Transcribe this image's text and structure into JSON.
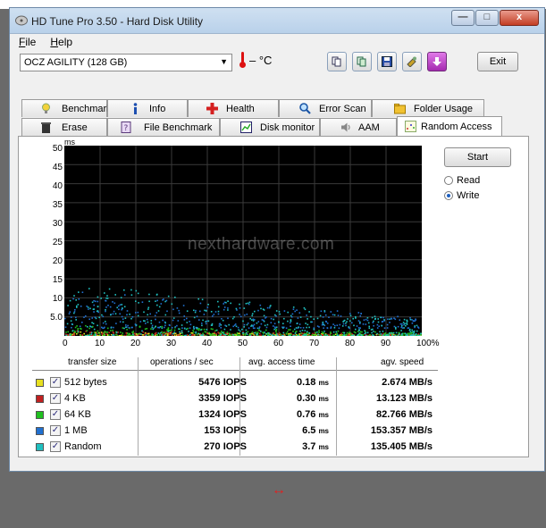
{
  "window": {
    "title": "HD Tune Pro 3.50 - Hard Disk Utility",
    "buttons": {
      "minimize": "—",
      "maximize": "□",
      "close": "x"
    }
  },
  "menu": [
    {
      "label": "File",
      "hotkey": "F",
      "rest": "ile"
    },
    {
      "label": "Help",
      "hotkey": "H",
      "rest": "elp"
    }
  ],
  "drive": {
    "selected": "OCZ AGILITY (128 GB)"
  },
  "temperature": {
    "text": "– °C"
  },
  "toolbar": {
    "icons": [
      "copy-icon",
      "copy-text-icon",
      "save-icon",
      "options-icon",
      "download-icon"
    ],
    "exit_label": "Exit"
  },
  "tabs": {
    "row_back": [
      {
        "label": "Benchmark",
        "icon": "benchmark-icon"
      },
      {
        "label": "Info",
        "icon": "info-icon"
      },
      {
        "label": "Health",
        "icon": "health-icon"
      },
      {
        "label": "Error Scan",
        "icon": "error-scan-icon"
      },
      {
        "label": "Folder Usage",
        "icon": "folder-usage-icon"
      }
    ],
    "row_front": [
      {
        "label": "Erase",
        "icon": "erase-icon"
      },
      {
        "label": "File Benchmark",
        "icon": "file-benchmark-icon"
      },
      {
        "label": "Disk monitor",
        "icon": "disk-monitor-icon"
      },
      {
        "label": "AAM",
        "icon": "aam-icon"
      },
      {
        "label": "Random Access",
        "icon": "random-access-icon",
        "active": true
      }
    ]
  },
  "controls": {
    "start_label": "Start",
    "read_label": "Read",
    "write_label": "Write",
    "mode_selected": "Write"
  },
  "watermark": "nexthardware.com",
  "colors": {
    "512 bytes": "#e8e020",
    "4 KB": "#c02020",
    "64 KB": "#20c020",
    "1 MB": "#2070d0",
    "Random": "#20c0c0"
  },
  "chart_data": {
    "type": "scatter",
    "ylabel": "ms",
    "ylim": [
      0,
      50
    ],
    "y_ticks": [
      "50",
      "45",
      "40",
      "35",
      "30",
      "25",
      "20",
      "15",
      "10",
      "5.0"
    ],
    "xlim": [
      0,
      100
    ],
    "x_ticks": [
      "0",
      "10",
      "20",
      "30",
      "40",
      "50",
      "60",
      "70",
      "80",
      "90",
      "100%"
    ],
    "grid": true,
    "series": [
      {
        "name": "512 bytes",
        "band_ms": [
          0,
          1
        ]
      },
      {
        "name": "4 KB",
        "band_ms": [
          0,
          1.5
        ]
      },
      {
        "name": "64 KB",
        "band_ms": [
          0,
          3
        ]
      },
      {
        "name": "1 MB",
        "band_ms": [
          2,
          12
        ]
      },
      {
        "name": "Random",
        "band_ms": [
          0,
          14
        ]
      }
    ]
  },
  "results": {
    "headers": [
      "transfer size",
      "operations / sec",
      "avg. access time",
      "agv. speed"
    ],
    "rows": [
      {
        "size": "512 bytes",
        "ops": "5476 IOPS",
        "access": "0.18",
        "access_unit": "ms",
        "speed": "2.674 MB/s"
      },
      {
        "size": "4 KB",
        "ops": "3359 IOPS",
        "access": "0.30",
        "access_unit": "ms",
        "speed": "13.123 MB/s"
      },
      {
        "size": "64 KB",
        "ops": "1324 IOPS",
        "access": "0.76",
        "access_unit": "ms",
        "speed": "82.766 MB/s"
      },
      {
        "size": "1 MB",
        "ops": "153 IOPS",
        "access": "6.5",
        "access_unit": "ms",
        "speed": "153.357 MB/s"
      },
      {
        "size": "Random",
        "ops": "270 IOPS",
        "access": "3.7",
        "access_unit": "ms",
        "speed": "135.405 MB/s"
      }
    ],
    "check_mark": "✓"
  },
  "resize_arrow": "↔"
}
